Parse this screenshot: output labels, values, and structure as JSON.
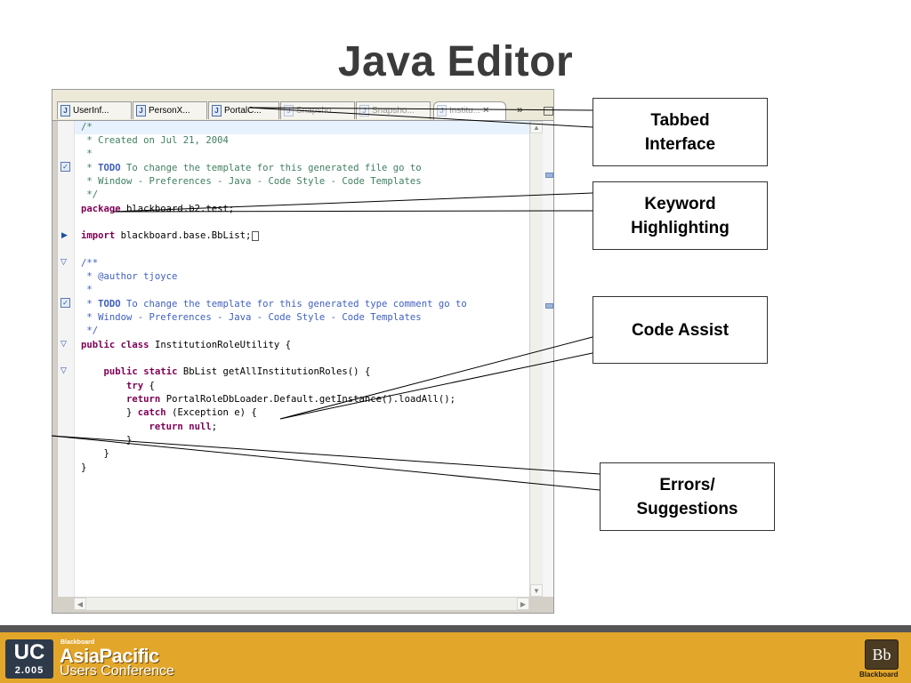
{
  "slide": {
    "title": "Java Editor"
  },
  "editor": {
    "tabs": [
      {
        "label": "UserInf...",
        "faded": false
      },
      {
        "label": "PersonX...",
        "faded": false
      },
      {
        "label": "PortalC...",
        "faded": false
      },
      {
        "label": "Snapsho...",
        "faded": true
      },
      {
        "label": "Snapsho...",
        "faded": true
      },
      {
        "label": "Institu...",
        "faded": true,
        "active": true
      }
    ],
    "overflow_label": "»",
    "code": {
      "l1": "/*",
      "l2": " * Created on Jul 21, 2004",
      "l3": " *",
      "l4_tag": "TODO",
      "l4_rest": " To change the template for this generated file go to",
      "l5": " * Window - Preferences - Java - Code Style - Code Templates",
      "l6": " */",
      "l7_kw": "package",
      "l7_rest": " blackboard.b2.test;",
      "l8_kw": "import",
      "l8_rest": " blackboard.base.BbList;",
      "l9": "/**",
      "l10": " * @author tjoyce",
      "l11": " *",
      "l12_tag": "TODO",
      "l12_rest": " To change the template for this generated type comment go to",
      "l13": " * Window - Preferences - Java - Code Style - Code Templates",
      "l14": " */",
      "l15_kw1": "public",
      "l15_kw2": "class",
      "l15_rest": " InstitutionRoleUtility {",
      "l16_kw1": "public",
      "l16_kw2": "static",
      "l16_rest": " BbList getAllInstitutionRoles() {",
      "l17_kw": "try",
      "l17_rest": " {",
      "l18_kw": "return",
      "l18_rest": " PortalRoleDbLoader.Default.getInstance().loadAll();",
      "l19_pre": "} ",
      "l19_kw": "catch",
      "l19_rest": " (Exception e) {",
      "l20_kw1": "return",
      "l20_kw2": "null",
      "l20_rest": ";",
      "l21": "}",
      "l22": "}",
      "l23": "}"
    }
  },
  "callouts": {
    "tabbed": "Tabbed\nInterface",
    "keyword": "Keyword\nHighlighting",
    "assist": "Code Assist",
    "errors": "Errors/\nSuggestions"
  },
  "footer": {
    "uc_logo": "UC",
    "uc_year": "2.005",
    "brand_small": "Blackboard",
    "brand_main": "AsiaPacific",
    "brand_sub": "Users Conference",
    "bb_logo": "Bb",
    "bb_label": "Blackboard"
  },
  "colors": {
    "keyword": "#7f0055",
    "comment": "#3f7f5f",
    "javadoc": "#3f5fbf",
    "footer_bar": "#e2a62a",
    "footer_strip": "#555555"
  }
}
